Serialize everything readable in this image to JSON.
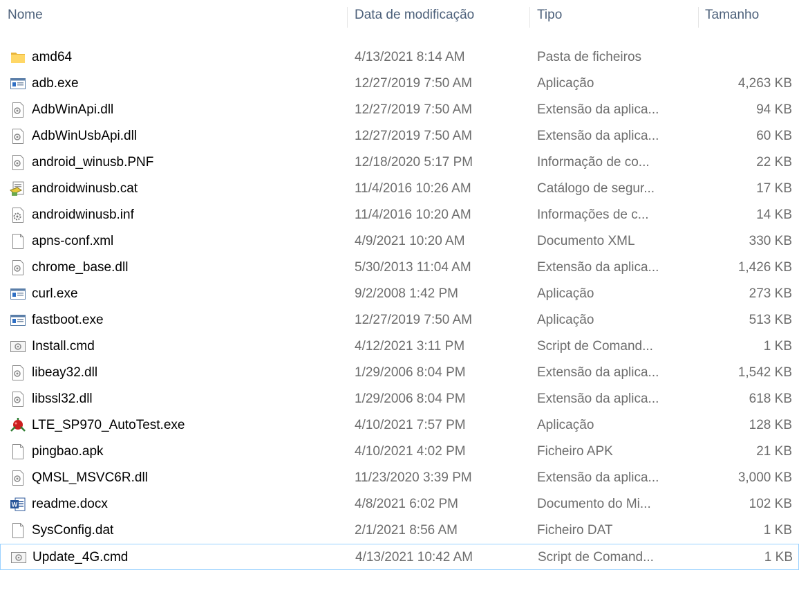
{
  "columns": {
    "name": "Nome",
    "date": "Data de modificação",
    "type": "Tipo",
    "size": "Tamanho"
  },
  "files": [
    {
      "icon": "folder-icon",
      "name": "amd64",
      "date": "4/13/2021 8:14 AM",
      "type": "Pasta de ficheiros",
      "size": ""
    },
    {
      "icon": "exe-icon",
      "name": "adb.exe",
      "date": "12/27/2019 7:50 AM",
      "type": "Aplicação",
      "size": "4,263 KB"
    },
    {
      "icon": "dll-icon",
      "name": "AdbWinApi.dll",
      "date": "12/27/2019 7:50 AM",
      "type": "Extensão da aplica...",
      "size": "94 KB"
    },
    {
      "icon": "dll-icon",
      "name": "AdbWinUsbApi.dll",
      "date": "12/27/2019 7:50 AM",
      "type": "Extensão da aplica...",
      "size": "60 KB"
    },
    {
      "icon": "dll-icon",
      "name": "android_winusb.PNF",
      "date": "12/18/2020 5:17 PM",
      "type": "Informação de co...",
      "size": "22 KB"
    },
    {
      "icon": "catalog-icon",
      "name": "androidwinusb.cat",
      "date": "11/4/2016 10:26 AM",
      "type": "Catálogo de segur...",
      "size": "17 KB"
    },
    {
      "icon": "inf-icon",
      "name": "androidwinusb.inf",
      "date": "11/4/2016 10:20 AM",
      "type": "Informações de c...",
      "size": "14 KB"
    },
    {
      "icon": "file-icon",
      "name": "apns-conf.xml",
      "date": "4/9/2021 10:20 AM",
      "type": "Documento XML",
      "size": "330 KB"
    },
    {
      "icon": "dll-icon",
      "name": "chrome_base.dll",
      "date": "5/30/2013 11:04 AM",
      "type": "Extensão da aplica...",
      "size": "1,426 KB"
    },
    {
      "icon": "exe-icon",
      "name": "curl.exe",
      "date": "9/2/2008 1:42 PM",
      "type": "Aplicação",
      "size": "273 KB"
    },
    {
      "icon": "exe-icon",
      "name": "fastboot.exe",
      "date": "12/27/2019 7:50 AM",
      "type": "Aplicação",
      "size": "513 KB"
    },
    {
      "icon": "cmd-icon",
      "name": "Install.cmd",
      "date": "4/12/2021 3:11 PM",
      "type": "Script de Comand...",
      "size": "1 KB"
    },
    {
      "icon": "dll-icon",
      "name": "libeay32.dll",
      "date": "1/29/2006 8:04 PM",
      "type": "Extensão da aplica...",
      "size": "1,542 KB"
    },
    {
      "icon": "dll-icon",
      "name": "libssl32.dll",
      "date": "1/29/2006 8:04 PM",
      "type": "Extensão da aplica...",
      "size": "618 KB"
    },
    {
      "icon": "app-custom-icon",
      "name": "LTE_SP970_AutoTest.exe",
      "date": "4/10/2021 7:57 PM",
      "type": "Aplicação",
      "size": "128 KB"
    },
    {
      "icon": "file-icon",
      "name": "pingbao.apk",
      "date": "4/10/2021 4:02 PM",
      "type": "Ficheiro APK",
      "size": "21 KB"
    },
    {
      "icon": "dll-icon",
      "name": "QMSL_MSVC6R.dll",
      "date": "11/23/2020 3:39 PM",
      "type": "Extensão da aplica...",
      "size": "3,000 KB"
    },
    {
      "icon": "word-icon",
      "name": "readme.docx",
      "date": "4/8/2021 6:02 PM",
      "type": "Documento do Mi...",
      "size": "102 KB"
    },
    {
      "icon": "file-icon",
      "name": "SysConfig.dat",
      "date": "2/1/2021 8:56 AM",
      "type": "Ficheiro DAT",
      "size": "1 KB"
    },
    {
      "icon": "cmd-icon",
      "name": "Update_4G.cmd",
      "date": "4/13/2021 10:42 AM",
      "type": "Script de Comand...",
      "size": "1 KB",
      "selected": true
    }
  ],
  "colors": {
    "header_text": "#4c607a",
    "detail_text": "#6d6d6d",
    "selection_border": "#99d1ff",
    "folder": "#ffd766"
  }
}
